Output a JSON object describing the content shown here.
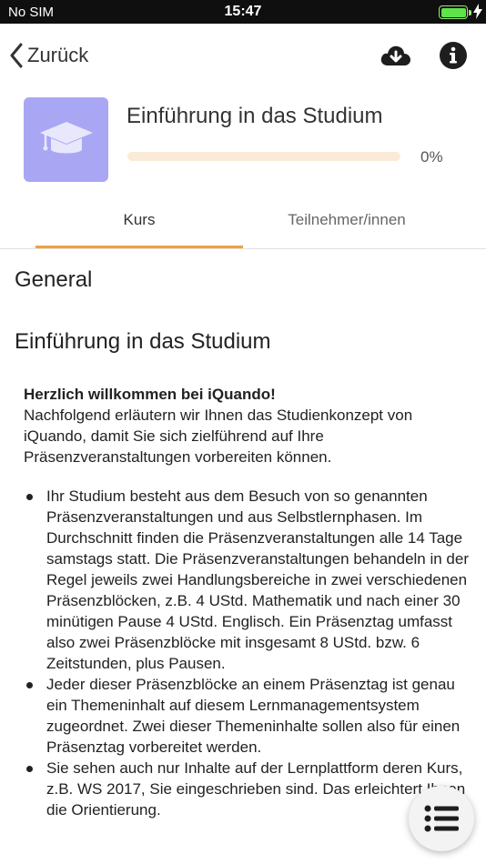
{
  "status_bar": {
    "carrier": "No SIM",
    "time": "15:47",
    "battery_level": 1.0
  },
  "nav": {
    "back_label": "Zurück",
    "icons": {
      "back": "chevron-left-icon",
      "download": "cloud-download-icon",
      "info": "info-icon"
    }
  },
  "course": {
    "icon": "graduation-cap-icon",
    "icon_bg": "#a9a7f4",
    "title": "Einführung in das Studium",
    "progress_percent": 0,
    "progress_text": "0%"
  },
  "tabs": [
    {
      "label": "Kurs",
      "active": true
    },
    {
      "label": "Teilnehmer/innen",
      "active": false
    }
  ],
  "sections": [
    {
      "title": "General"
    },
    {
      "title": "Einführung in das Studium"
    }
  ],
  "content": {
    "welcome": "Herzlich willkommen bei iQuando!",
    "intro": "Nachfolgend erläutern wir Ihnen das Studienkonzept von iQuando, damit Sie sich zielführend auf Ihre Präsenzveranstaltungen vorbereiten können.",
    "bullets": [
      "Ihr Studium besteht aus dem Besuch von so genannten Präsenzveranstaltungen und aus Selbstlernphasen. Im Durchschnitt finden die Präsenzveranstaltungen alle 14 Tage samstags statt. Die Präsenzveranstaltungen behandeln in der Regel jeweils zwei Handlungsbereiche in zwei verschiedenen Präsenzblöcken, z.B. 4 UStd. Mathematik und nach einer 30 minütigen Pause 4 UStd. Englisch. Ein Präsenztag umfasst also zwei Präsenzblöcke mit insgesamt 8 UStd. bzw. 6 Zeitstunden, plus Pausen.",
      "Jeder dieser Präsenzblöcke an einem Präsenztag ist genau ein Themeninhalt auf diesem Lernmanagementsystem zugeordnet. Zwei dieser Themeninhalte sollen also für einen Präsenztag vorbereitet werden.",
      "Sie sehen auch nur Inhalte auf der Lernplattform deren Kurs, z.B. WS 2017, Sie eingeschrieben sind. Das erleichtert Ihnen die Orientierung."
    ]
  },
  "fab": {
    "icon": "list-menu-icon"
  },
  "colors": {
    "accent": "#f0a040",
    "progress_track": "#faead8"
  }
}
